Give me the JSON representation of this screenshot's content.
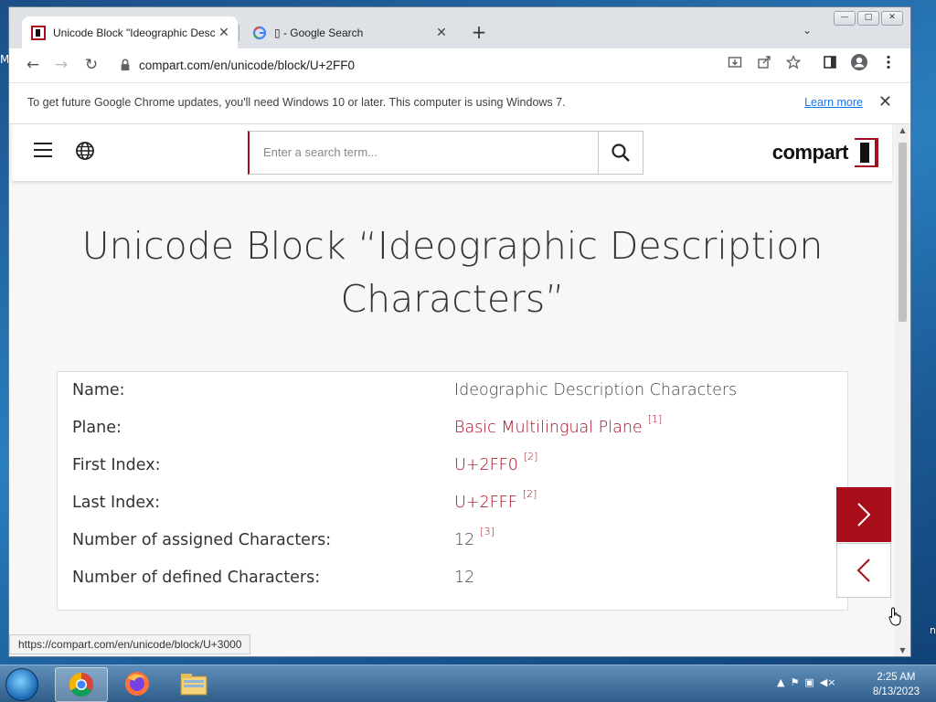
{
  "desktop": {
    "left_glyph": "M",
    "right_glyph": "n"
  },
  "browser": {
    "tabs": [
      {
        "title": "Unicode Block \"Ideographic Desc",
        "active": true,
        "favicon": "compart-favicon"
      },
      {
        "title": "▯ - Google Search",
        "active": false,
        "favicon": "google-favicon"
      }
    ],
    "new_tab_label": "+",
    "address": "compart.com/en/unicode/block/U+2FF0",
    "window_controls": [
      "—",
      "□",
      "✕"
    ]
  },
  "infobar": {
    "message": "To get future Google Chrome updates, you'll need Windows 10 or later. This computer is using Windows 7.",
    "learn_more": "Learn more"
  },
  "site": {
    "search_placeholder": "Enter a search term...",
    "logo_text": "compart",
    "heading_line1": "Unicode Block “Ideographic Description",
    "heading_line2": "Characters”",
    "rows": [
      {
        "key": "Name:",
        "value": "Ideographic Description Characters",
        "ref": "",
        "link": false
      },
      {
        "key": "Plane:",
        "value": "Basic Multilingual Plane",
        "ref": "[1]",
        "link": true
      },
      {
        "key": "First Index:",
        "value": "U+2FF0",
        "ref": "[2]",
        "link": true
      },
      {
        "key": "Last Index:",
        "value": "U+2FFF",
        "ref": "[2]",
        "link": true
      },
      {
        "key": "Number of assigned Characters:",
        "value": "12",
        "ref": "[3]",
        "link": false
      },
      {
        "key": "Number of defined Characters:",
        "value": "12",
        "ref": "",
        "link": false
      }
    ]
  },
  "status_bar_url": "https://compart.com/en/unicode/block/U+3000",
  "taskbar": {
    "time": "2:25 AM",
    "date": "8/13/2023",
    "apps": [
      "chrome",
      "firefox",
      "file-explorer"
    ]
  },
  "colors": {
    "brand_red": "#a30d1d",
    "link_blue": "#1a73e8"
  }
}
